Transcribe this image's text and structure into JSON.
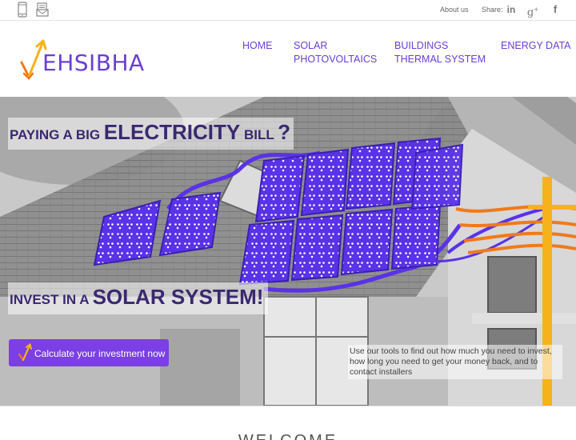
{
  "topbar": {
    "about_label": "About us",
    "share_label": "Share:",
    "icons": [
      "phone-icon",
      "mail-icon",
      "linkedin-icon",
      "google-plus-icon",
      "facebook-icon"
    ]
  },
  "header": {
    "logo_text": "EHSIBHA",
    "nav": [
      {
        "label_line1": "HOME",
        "label_line2": ""
      },
      {
        "label_line1": "SOLAR",
        "label_line2": "PHOTOVOLTAICS"
      },
      {
        "label_line1": "BUILDINGS",
        "label_line2": "THERMAL SYSTEM"
      },
      {
        "label_line1": "ENERGY DATA",
        "label_line2": ""
      }
    ]
  },
  "hero": {
    "headline1": {
      "part1": "PAYING A BIG ",
      "part2": "ELECTRICITY",
      "part3": " BILL ",
      "part4": "?"
    },
    "headline2": {
      "part1": "INVEST IN A ",
      "part2": "SOLAR SYSTEM!"
    },
    "cta_label": "Calculate your investment now",
    "info_text": "Use our tools to find out how much you need to invest, how long you need to get your money back, and to contact installers"
  },
  "welcome_heading": "WELCOME",
  "colors": {
    "brand_purple": "#6a3fd4",
    "button_purple": "#7b3fe4",
    "panel_blue": "#5a32e8",
    "accent_orange": "#f07a1a",
    "accent_yellow": "#f7b21b"
  }
}
